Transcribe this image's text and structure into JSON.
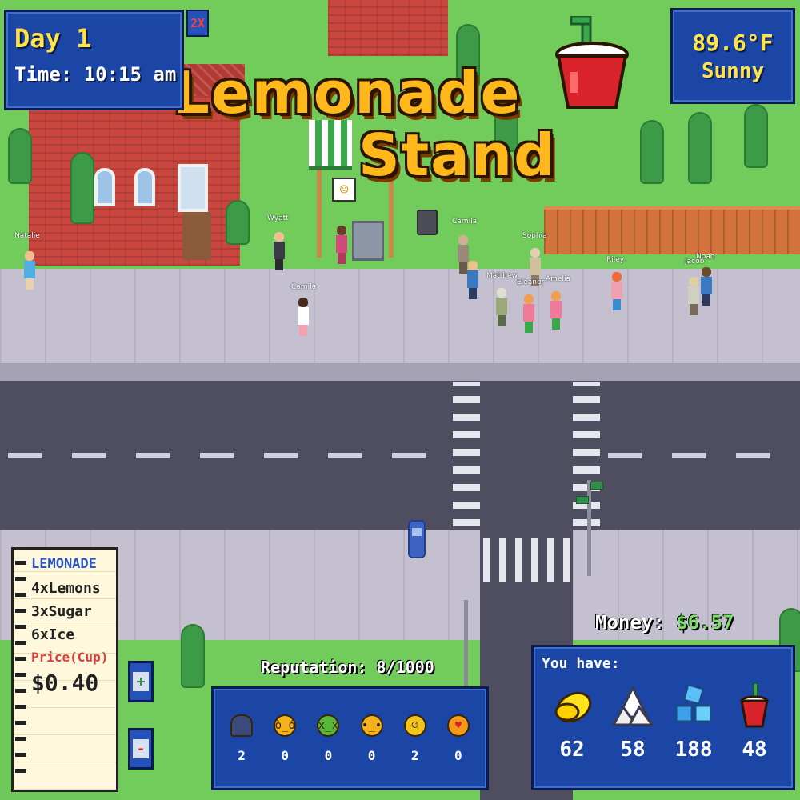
{
  "hud": {
    "day_label": "Day 1",
    "time_label": "Time: 10:15 am",
    "speed_label": "2X"
  },
  "weather": {
    "temperature": "89.6°F",
    "condition": "Sunny"
  },
  "logo": {
    "line1": "Lemonade",
    "line2": "Stand"
  },
  "people": [
    {
      "name": "Natalie"
    },
    {
      "name": "Wyatt"
    },
    {
      "name": "Camila"
    },
    {
      "name": "Camila"
    },
    {
      "name": "Sophia"
    },
    {
      "name": "Matthew"
    },
    {
      "name": "Eleanor"
    },
    {
      "name": "Amelia"
    },
    {
      "name": "Riley"
    },
    {
      "name": "Jacob"
    },
    {
      "name": "Noah"
    }
  ],
  "recipe": {
    "title": "LEMONADE",
    "lemons": "4xLemons",
    "sugar": "3xSugar",
    "ice": "6xIce",
    "price_label": "Price(Cup)",
    "price_value": "$0.40",
    "increase_label": "+",
    "decrease_label": "-"
  },
  "reputation": {
    "label": "Reputation: 8/1000",
    "faces": [
      {
        "icon": "silhouette-icon",
        "count": "2",
        "color": "#3a4a7a"
      },
      {
        "icon": "angry-face-icon",
        "count": "0",
        "color": "#f3b21a"
      },
      {
        "icon": "sick-face-icon",
        "count": "0",
        "color": "#59b83a"
      },
      {
        "icon": "neutral-face-icon",
        "count": "0",
        "color": "#f3b21a"
      },
      {
        "icon": "happy-face-icon",
        "count": "2",
        "color": "#f3c51a"
      },
      {
        "icon": "love-face-icon",
        "count": "0",
        "color": "#f39a1a"
      }
    ]
  },
  "money": {
    "label": "Money:",
    "amount": "$6.57"
  },
  "inventory": {
    "title": "You have:",
    "items": [
      {
        "icon": "lemon-icon",
        "count": "62"
      },
      {
        "icon": "sugar-icon",
        "count": "58"
      },
      {
        "icon": "ice-icon",
        "count": "188"
      },
      {
        "icon": "cup-icon",
        "count": "48"
      }
    ]
  },
  "colors": {
    "hud_panel": "#1c46a6",
    "hud_text_yellow": "#ffe347",
    "logo_orange": "#ffb81c"
  }
}
